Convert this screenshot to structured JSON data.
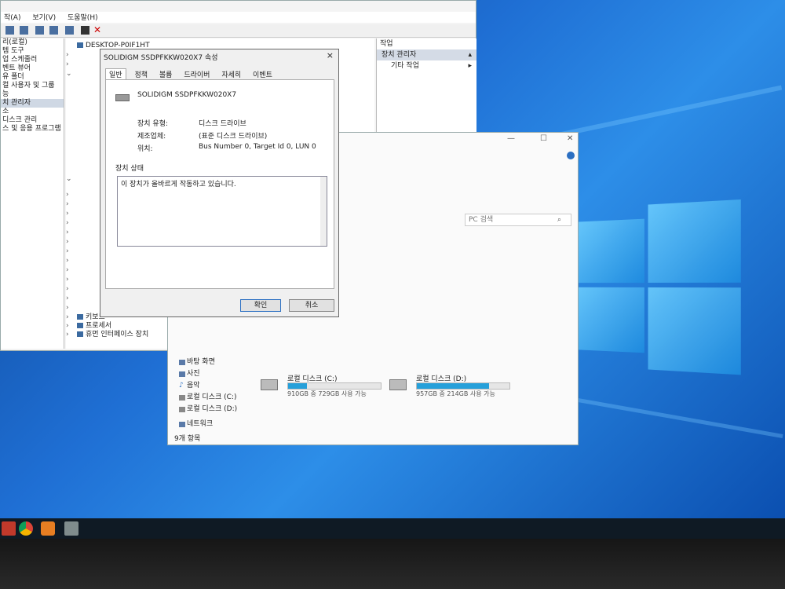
{
  "mgmt": {
    "menu": [
      "작(A)",
      "보기(V)",
      "도움말(H)"
    ],
    "left_tree": [
      "리(로컬)",
      "템 도구",
      "업 스케줄러",
      "벤트 뷰어",
      "유 폴더",
      "컬 사용자 및 그룹",
      "능",
      "치 관리자",
      "소",
      "디스크 관리",
      "스 및 응용 프로그램"
    ],
    "device_root": "DESKTOP-P0IF1HT",
    "device_rows": [
      "키보드",
      "프로세서",
      "휴먼 인터페이스 장치"
    ],
    "actions": {
      "header": "작업",
      "selected": "장치 관리자",
      "more": "기타 작업"
    }
  },
  "props": {
    "title": "SOLIDIGM SSDPFKKW020X7 속성",
    "close": "×",
    "tabs": [
      "일반",
      "정책",
      "볼륨",
      "드라이버",
      "자세히",
      "이벤트"
    ],
    "device_name": "SOLIDIGM SSDPFKKW020X7",
    "fields": [
      {
        "key": "장치 유형:",
        "value": "디스크 드라이브"
      },
      {
        "key": "제조업체:",
        "value": "(표준 디스크 드라이브)"
      },
      {
        "key": "위치:",
        "value": "Bus Number 0, Target Id 0, LUN 0"
      }
    ],
    "status_group": "장치 상태",
    "status_text": "이 장치가 올바르게 작동하고 있습니다.",
    "ok": "확인",
    "cancel": "취소"
  },
  "explorer": {
    "search_placeholder": "PC 검색",
    "nav": [
      "바탕 화면",
      "사진",
      "음악",
      "로컬 디스크 (C:)",
      "로컬 디스크 (D:)",
      "네트워크"
    ],
    "drives": [
      {
        "name": "로컬 디스크 (C:)",
        "detail": "910GB 중 729GB 사용 가능",
        "used_fraction": 0.2
      },
      {
        "name": "로컬 디스크 (D:)",
        "detail": "957GB 중 214GB 사용 가능",
        "used_fraction": 0.78
      }
    ],
    "status": "9개 항목"
  },
  "colors": {
    "accent": "#26a0da",
    "selection": "#d4dbe6"
  }
}
